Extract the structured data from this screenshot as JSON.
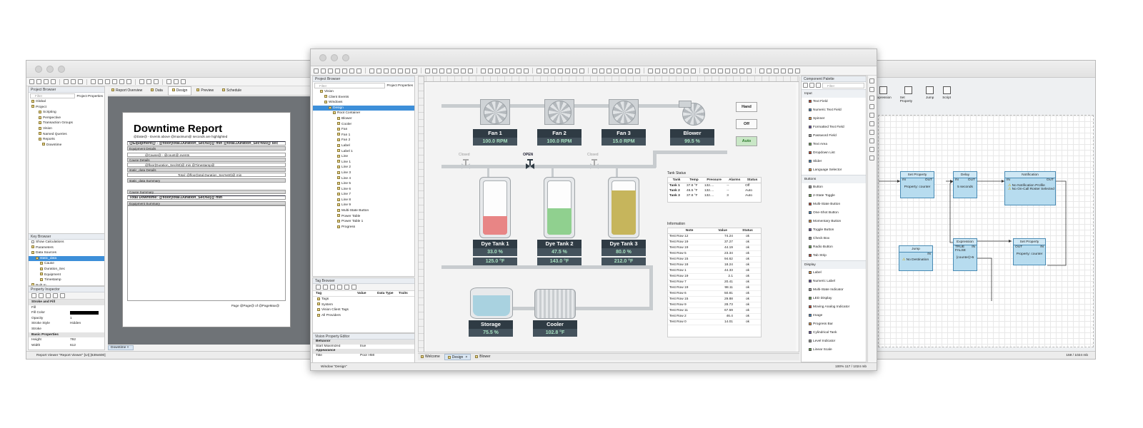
{
  "report_window": {
    "project_browser_title": "Project Browser",
    "filter_placeholder": "Filter",
    "project_properties": "Project Properties",
    "tree": [
      "Global",
      "Project",
      "Scripting",
      "Perspective",
      "Transaction Groups",
      "Vision",
      "Named Queries",
      "Reports",
      "Downtime"
    ],
    "tabs": [
      "Report Overview",
      "Data",
      "Design",
      "Preview",
      "Schedule"
    ],
    "report_title": "Downtime Report",
    "report_subtitle": "@Date@ - Events above @maximum@ seconds are highlighted",
    "rows": [
      "@Equipment@ - @floor(total.Duration_Sec/60)@ min @total.Duration_Sec%60@ sec",
      "Equipment Details",
      "@Cause@ - @count@ events",
      "Cause Details",
      "@floor(Duration_Sec/60)@ min  @Timestamp@",
      "static_data Details",
      "Total: @floor(total.Duration_Sec%60)@ min",
      "static_data Summary",
      "Cause Summary",
      "Total Downtime: @floor(total.Duration_Sec/60)@ min",
      "Equipment Summary"
    ],
    "page_footer": "Page @Page@ of @PageMax@",
    "key_browser_title": "Key Browser",
    "show_calc": "Show Calculations",
    "key_tree": [
      "Parameters",
      "Data Sources",
      "static_data",
      "Cause",
      "Duration_Sec",
      "Equipment",
      "Timestamp",
      "Built In"
    ],
    "prop_inspector_title": "Property Inspector",
    "props": [
      [
        "Stroke and Fill",
        ""
      ],
      [
        "Fill",
        ""
      ],
      [
        "Fill Color",
        ""
      ],
      [
        "Opacity",
        "1"
      ],
      [
        "Stroke Style",
        "Hidden"
      ],
      [
        "Stroke",
        ""
      ],
      [
        "Basic Properties",
        ""
      ],
      [
        "Height",
        "792"
      ],
      [
        "Width",
        "612"
      ]
    ],
    "doc_tab": "Downtime",
    "status": "Report Viewer \"Report Viewer\" [UI] [639x600]"
  },
  "designer_window": {
    "project_browser_title": "Project Browser",
    "filter_placeholder": "Filter",
    "project_properties": "Project Properties",
    "tree": [
      "Vision",
      "Client Events",
      "Windows",
      "Design",
      "Root Container",
      "Blower",
      "Cooler",
      "Fan",
      "Fan 1",
      "Fan 2",
      "Label",
      "Label 1",
      "Line",
      "Line 1",
      "Line 2",
      "Line 3",
      "Line 4",
      "Line 5",
      "Line 6",
      "Line 7",
      "Line 8",
      "Line 9",
      "Multi-State Button",
      "Power Table",
      "Power Table 1",
      "Progress"
    ],
    "tag_browser_title": "Tag Browser",
    "tag_cols": [
      "Tag",
      "Value",
      "Data Type",
      "Traits"
    ],
    "tags": [
      "Tags",
      "System",
      "Vision Client Tags",
      "All Providers"
    ],
    "vpe_title": "Vision Property Editor",
    "vpe": [
      [
        "Behavior",
        ""
      ],
      [
        "Start Maximized",
        "true"
      ],
      [
        "Appearance",
        ""
      ],
      [
        "Title",
        "Poor HMI"
      ],
      [
        "Border Display Policy",
        "When Not Maximized"
      ],
      [
        "Titlebar Display Policy",
        "When Not Maximized"
      ],
      [
        "Layout",
        ""
      ],
      [
        "Dock Position",
        "Floating"
      ],
      [
        "Location",
        "X: 0    Y: 0"
      ],
      [
        "Size",
        "Width: 1269    Height: 927"
      ]
    ],
    "fans": [
      {
        "name": "Fan 1",
        "value": "100.0 RPM"
      },
      {
        "name": "Fan 2",
        "value": "100.0 RPM"
      },
      {
        "name": "Fan 3",
        "value": "15.0 RPM"
      }
    ],
    "blower": {
      "name": "Blower",
      "value": "99.5 %"
    },
    "buttons": [
      "Hand",
      "Off",
      "Auto"
    ],
    "valves": [
      "Closed",
      "OPEN",
      "Closed"
    ],
    "tanks": [
      {
        "name": "Dye Tank 1",
        "level_pct": 33.0,
        "level": "33.0 %",
        "temp": "125.0 °F",
        "color": "#e88585"
      },
      {
        "name": "Dye Tank 2",
        "level_pct": 47.5,
        "level": "47.5 %",
        "temp": "143.0 °F",
        "color": "#90d08f"
      },
      {
        "name": "Dye Tank 3",
        "level_pct": 80.0,
        "level": "80.0 %",
        "temp": "212.0 °F",
        "color": "#c6b55c"
      }
    ],
    "storage": {
      "name": "Storage",
      "value": "75.5 %",
      "level_pct": 75.5
    },
    "cooler": {
      "name": "Cooler",
      "value": "102.8 °F"
    },
    "tank_status_title": "Tank Status",
    "tank_status_cols": [
      "Tank",
      "Temp",
      "Pressure",
      "Alarms",
      "Status"
    ],
    "tank_status": [
      [
        "Tank 1",
        "37.8 °F",
        "132....",
        "--",
        "Off"
      ],
      [
        "Tank 2",
        "46.5 °F",
        "132....",
        "--",
        "Auto"
      ],
      [
        "Tank 3",
        "37.8 °F",
        "132....",
        "3",
        "Auto"
      ]
    ],
    "info_title": "Information",
    "info_cols": [
      "Note",
      "Value",
      "Status"
    ],
    "info": [
      [
        "Test Row 12",
        "74.24",
        "ok"
      ],
      [
        "Test Row 19",
        "37.27",
        "ok"
      ],
      [
        "Test Row 19",
        "44.19",
        "ok"
      ],
      [
        "Test Row 5",
        "23.34",
        "ok"
      ],
      [
        "Test Row 15",
        "94.62",
        "ok"
      ],
      [
        "Test Row 18",
        "18.24",
        "ok"
      ],
      [
        "Test Row 1",
        "44.33",
        "ok"
      ],
      [
        "Test Row 19",
        "2.1",
        "ok"
      ],
      [
        "Test Row 7",
        "20.41",
        "ok"
      ],
      [
        "Test Row 19",
        "98.11",
        "ok"
      ],
      [
        "Test Row 6",
        "50.81",
        "ok"
      ],
      [
        "Test Row 15",
        "29.88",
        "ok"
      ],
      [
        "Test Row 9",
        "28.73",
        "ok"
      ],
      [
        "Test Row 11",
        "67.59",
        "ok"
      ],
      [
        "Test Row 2",
        "46.4",
        "ok"
      ],
      [
        "Test Row 0",
        "14.01",
        "ok"
      ]
    ],
    "doc_tabs": [
      "Welcome",
      "Design",
      "Blower"
    ],
    "palette_title": "Component Palette",
    "palette_filter": "Filter",
    "palette": [
      [
        "Input",
        ""
      ],
      [
        "",
        "Text Field"
      ],
      [
        "",
        "Numeric Text Field"
      ],
      [
        "",
        "Spinner"
      ],
      [
        "",
        "Formatted Text Field"
      ],
      [
        "",
        "Password Field"
      ],
      [
        "",
        "Text Area"
      ],
      [
        "",
        "Dropdown List"
      ],
      [
        "",
        "Slider"
      ],
      [
        "",
        "Language Selector"
      ],
      [
        "Buttons",
        ""
      ],
      [
        "",
        "Button"
      ],
      [
        "",
        "2-State Toggle"
      ],
      [
        "",
        "Multi-State Button"
      ],
      [
        "",
        "One-Shot Button"
      ],
      [
        "",
        "Momentary Button"
      ],
      [
        "",
        "Toggle Button"
      ],
      [
        "",
        "Check Box"
      ],
      [
        "",
        "Radio Button"
      ],
      [
        "",
        "Tab Strip"
      ],
      [
        "Display",
        ""
      ],
      [
        "",
        "Label"
      ],
      [
        "",
        "Numeric Label"
      ],
      [
        "",
        "Multi-State Indicator"
      ],
      [
        "",
        "LED Display"
      ],
      [
        "",
        "Moving Analog Indicator"
      ],
      [
        "",
        "Image"
      ],
      [
        "",
        "Progress Bar"
      ],
      [
        "",
        "Cylindrical Tank"
      ],
      [
        "",
        "Level Indicator"
      ],
      [
        "",
        "Linear Scale"
      ]
    ],
    "status_left": "Window \"Design\"",
    "status_right": "100%  117 / 1024 mb"
  },
  "pipeline_window": {
    "tools": [
      "Expression",
      "Set Property",
      "Jump",
      "Script"
    ],
    "nodes": [
      {
        "title": "Set Property",
        "body": "Property: counter"
      },
      {
        "title": "Delay",
        "body": "5 seconds"
      },
      {
        "title": "Notification",
        "body1": "No Notification Profile",
        "body2": "No On-Call Roster Selected"
      },
      {
        "title": "Expression",
        "true": "TRUE",
        "false": "FALSE",
        "expr": "{counter}>5"
      },
      {
        "title": "Set Property",
        "body": "Property: counter"
      },
      {
        "title": "Jump",
        "body": "No Destination"
      }
    ],
    "io": {
      "in": "IN",
      "out": "OUT"
    },
    "status": "159 / 1024 mb"
  }
}
